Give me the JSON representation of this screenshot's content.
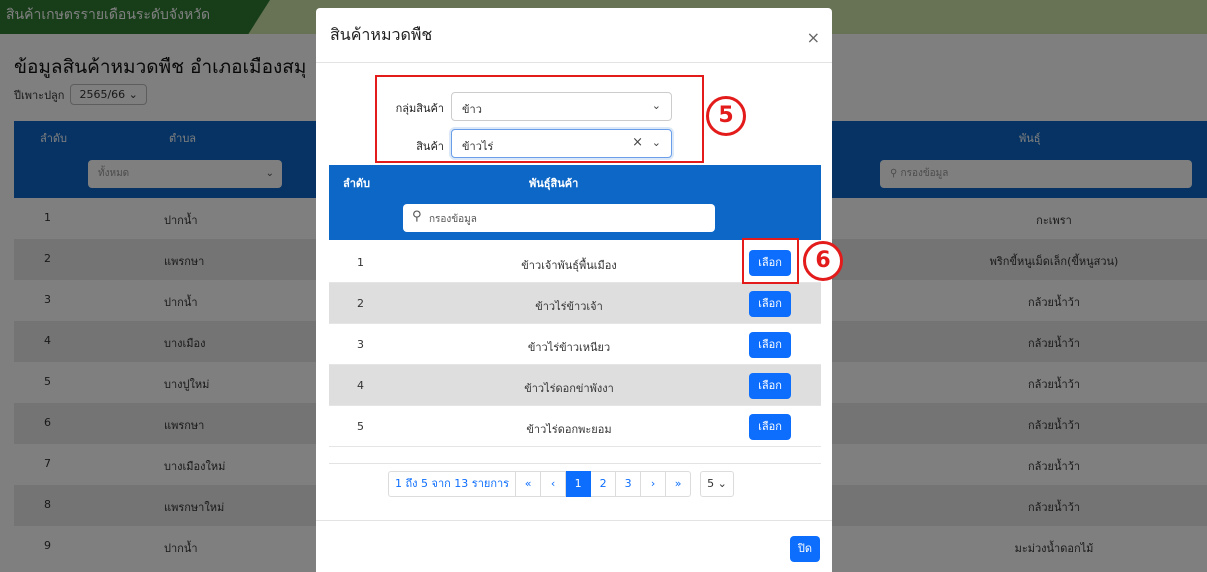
{
  "background": {
    "header_tab": "สินค้าเกษตรรายเดือนระดับจังหวัด",
    "header_right": "",
    "page_title": "ข้อมูลสินค้าหมวดพืช อำเภอเมืองสมุ",
    "season_label": "ปีเพาะปลูก",
    "season_value": "2565/66",
    "col_order": "ลำดับ",
    "col_subdistrict": "ตำบล",
    "col_variety": "พันธุ์",
    "filter_all": "ทั้งหมด",
    "filter_search": "กรองข้อมูล",
    "rows": [
      {
        "idx": "1",
        "sub": "ปากน้ำ",
        "var": "กะเพรา"
      },
      {
        "idx": "2",
        "sub": "แพรกษา",
        "var": "พริกขี้หนูเม็ดเล็ก(ขี้หนูสวน)"
      },
      {
        "idx": "3",
        "sub": "ปากน้ำ",
        "var": "กล้วยน้ำว้า"
      },
      {
        "idx": "4",
        "sub": "บางเมือง",
        "var": "กล้วยน้ำว้า"
      },
      {
        "idx": "5",
        "sub": "บางปูใหม่",
        "var": "กล้วยน้ำว้า"
      },
      {
        "idx": "6",
        "sub": "แพรกษา",
        "var": "กล้วยน้ำว้า"
      },
      {
        "idx": "7",
        "sub": "บางเมืองใหม่",
        "var": "กล้วยน้ำว้า"
      },
      {
        "idx": "8",
        "sub": "แพรกษาใหม่",
        "var": "กล้วยน้ำว้า"
      },
      {
        "idx": "9",
        "sub": "ปากน้ำ",
        "var": "มะม่วงน้ำดอกไม้"
      }
    ]
  },
  "modal": {
    "title": "สินค้าหมวดพืช",
    "close_symbol": "×",
    "group_label": "กลุ่มสินค้า",
    "group_value": "ข้าว",
    "product_label": "สินค้า",
    "product_value": "ข้าวไร่",
    "step5": "5",
    "step6": "6",
    "col_order": "ลำดับ",
    "col_variety": "พันธุ์สินค้า",
    "search_placeholder": "กรองข้อมูล",
    "select_label": "เลือก",
    "rows": [
      {
        "idx": "1",
        "name": "ข้าวเจ้าพันธุ์พื้นเมือง"
      },
      {
        "idx": "2",
        "name": "ข้าวไร่ข้าวเจ้า"
      },
      {
        "idx": "3",
        "name": "ข้าวไร่ข้าวเหนียว"
      },
      {
        "idx": "4",
        "name": "ข้าวไร่ดอกข่าพังงา"
      },
      {
        "idx": "5",
        "name": "ข้าวไร่ดอกพะยอม"
      }
    ],
    "pager": {
      "info": "1 ถึง 5 จาก 13 รายการ",
      "first": "«",
      "prev": "‹",
      "pages": [
        "1",
        "2",
        "3"
      ],
      "active_page": "1",
      "next": "›",
      "last": "»",
      "page_size": "5"
    },
    "close_button": "ปิด"
  },
  "colors": {
    "primary": "#0d6efd",
    "table_header": "#0d67c7",
    "highlight": "#e31b1b"
  }
}
